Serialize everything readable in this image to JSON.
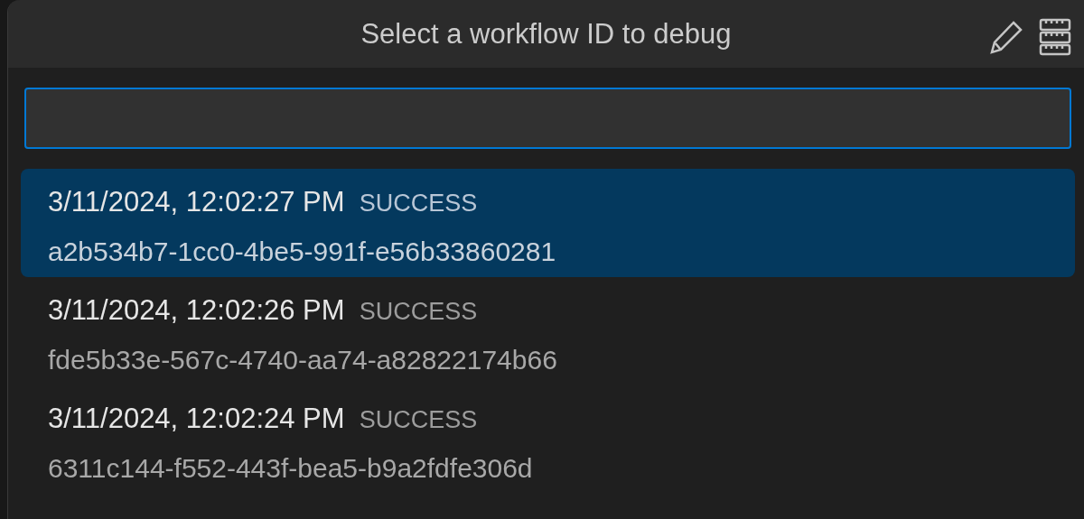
{
  "title": "Select a workflow ID to debug",
  "items": [
    {
      "time": "3/11/2024, 12:02:27 PM",
      "status": "SUCCESS",
      "id": "a2b534b7-1cc0-4be5-991f-e56b33860281",
      "selected": true
    },
    {
      "time": "3/11/2024, 12:02:26 PM",
      "status": "SUCCESS",
      "id": "fde5b33e-567c-4740-aa74-a82822174b66",
      "selected": false
    },
    {
      "time": "3/11/2024, 12:02:24 PM",
      "status": "SUCCESS",
      "id": "6311c144-f552-443f-bea5-b9a2fdfe306d",
      "selected": false
    }
  ]
}
